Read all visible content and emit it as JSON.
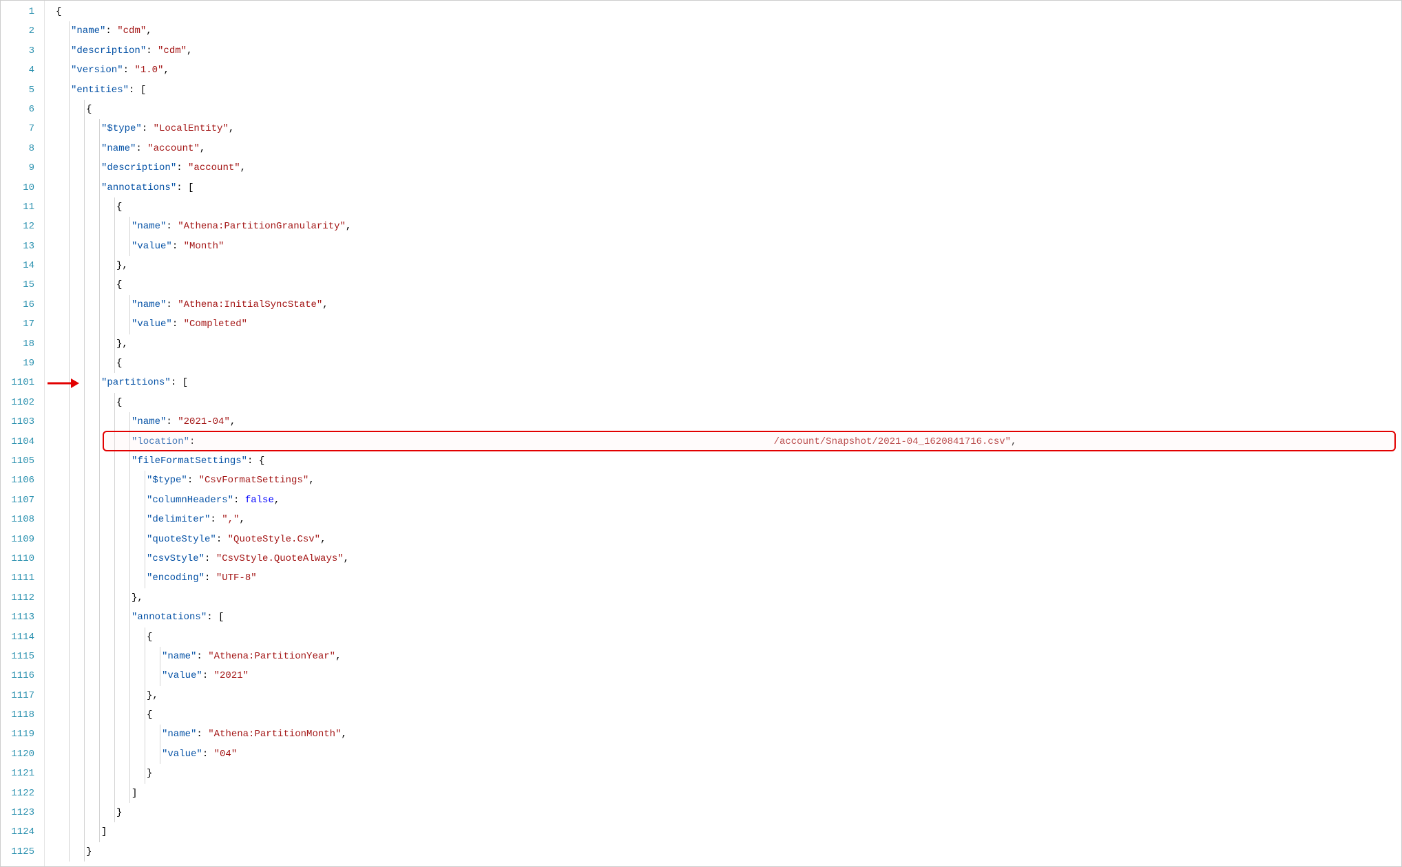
{
  "lines": [
    {
      "num": "1",
      "indent": 0,
      "tokens": [
        {
          "t": "punct",
          "v": "{"
        }
      ]
    },
    {
      "num": "2",
      "indent": 1,
      "tokens": [
        {
          "t": "key",
          "v": "\"name\""
        },
        {
          "t": "punct",
          "v": ": "
        },
        {
          "t": "str",
          "v": "\"cdm\""
        },
        {
          "t": "punct",
          "v": ","
        }
      ]
    },
    {
      "num": "3",
      "indent": 1,
      "tokens": [
        {
          "t": "key",
          "v": "\"description\""
        },
        {
          "t": "punct",
          "v": ": "
        },
        {
          "t": "str",
          "v": "\"cdm\""
        },
        {
          "t": "punct",
          "v": ","
        }
      ]
    },
    {
      "num": "4",
      "indent": 1,
      "tokens": [
        {
          "t": "key",
          "v": "\"version\""
        },
        {
          "t": "punct",
          "v": ": "
        },
        {
          "t": "str",
          "v": "\"1.0\""
        },
        {
          "t": "punct",
          "v": ","
        }
      ]
    },
    {
      "num": "5",
      "indent": 1,
      "tokens": [
        {
          "t": "key",
          "v": "\"entities\""
        },
        {
          "t": "punct",
          "v": ": ["
        }
      ]
    },
    {
      "num": "6",
      "indent": 2,
      "tokens": [
        {
          "t": "punct",
          "v": "{"
        }
      ]
    },
    {
      "num": "7",
      "indent": 3,
      "tokens": [
        {
          "t": "key",
          "v": "\"$type\""
        },
        {
          "t": "punct",
          "v": ": "
        },
        {
          "t": "str",
          "v": "\"LocalEntity\""
        },
        {
          "t": "punct",
          "v": ","
        }
      ]
    },
    {
      "num": "8",
      "indent": 3,
      "tokens": [
        {
          "t": "key",
          "v": "\"name\""
        },
        {
          "t": "punct",
          "v": ": "
        },
        {
          "t": "str",
          "v": "\"account\""
        },
        {
          "t": "punct",
          "v": ","
        }
      ]
    },
    {
      "num": "9",
      "indent": 3,
      "tokens": [
        {
          "t": "key",
          "v": "\"description\""
        },
        {
          "t": "punct",
          "v": ": "
        },
        {
          "t": "str",
          "v": "\"account\""
        },
        {
          "t": "punct",
          "v": ","
        }
      ]
    },
    {
      "num": "10",
      "indent": 3,
      "tokens": [
        {
          "t": "key",
          "v": "\"annotations\""
        },
        {
          "t": "punct",
          "v": ": ["
        }
      ]
    },
    {
      "num": "11",
      "indent": 4,
      "tokens": [
        {
          "t": "punct",
          "v": "{"
        }
      ]
    },
    {
      "num": "12",
      "indent": 5,
      "tokens": [
        {
          "t": "key",
          "v": "\"name\""
        },
        {
          "t": "punct",
          "v": ": "
        },
        {
          "t": "str",
          "v": "\"Athena:PartitionGranularity\""
        },
        {
          "t": "punct",
          "v": ","
        }
      ]
    },
    {
      "num": "13",
      "indent": 5,
      "tokens": [
        {
          "t": "key",
          "v": "\"value\""
        },
        {
          "t": "punct",
          "v": ": "
        },
        {
          "t": "str",
          "v": "\"Month\""
        }
      ]
    },
    {
      "num": "14",
      "indent": 4,
      "tokens": [
        {
          "t": "punct",
          "v": "},"
        }
      ]
    },
    {
      "num": "15",
      "indent": 4,
      "tokens": [
        {
          "t": "punct",
          "v": "{"
        }
      ]
    },
    {
      "num": "16",
      "indent": 5,
      "tokens": [
        {
          "t": "key",
          "v": "\"name\""
        },
        {
          "t": "punct",
          "v": ": "
        },
        {
          "t": "str",
          "v": "\"Athena:InitialSyncState\""
        },
        {
          "t": "punct",
          "v": ","
        }
      ]
    },
    {
      "num": "17",
      "indent": 5,
      "tokens": [
        {
          "t": "key",
          "v": "\"value\""
        },
        {
          "t": "punct",
          "v": ": "
        },
        {
          "t": "str",
          "v": "\"Completed\""
        }
      ]
    },
    {
      "num": "18",
      "indent": 4,
      "tokens": [
        {
          "t": "punct",
          "v": "},"
        }
      ]
    },
    {
      "num": "19",
      "indent": 4,
      "tokens": [
        {
          "t": "punct",
          "v": "{"
        }
      ]
    },
    {
      "num": "1101",
      "indent": 3,
      "tokens": [
        {
          "t": "key",
          "v": "\"partitions\""
        },
        {
          "t": "punct",
          "v": ": ["
        }
      ]
    },
    {
      "num": "1102",
      "indent": 4,
      "tokens": [
        {
          "t": "punct",
          "v": "{"
        }
      ]
    },
    {
      "num": "1103",
      "indent": 5,
      "tokens": [
        {
          "t": "key",
          "v": "\"name\""
        },
        {
          "t": "punct",
          "v": ": "
        },
        {
          "t": "str",
          "v": "\"2021-04\""
        },
        {
          "t": "punct",
          "v": ","
        }
      ]
    },
    {
      "num": "1104",
      "indent": 5,
      "tokens": [
        {
          "t": "key",
          "v": "\"location\""
        },
        {
          "t": "punct",
          "v": ": "
        },
        {
          "t": "str",
          "v": "                                                                                                   /account/Snapshot/2021-04_1620841716.csv\""
        },
        {
          "t": "punct",
          "v": ","
        }
      ]
    },
    {
      "num": "1105",
      "indent": 5,
      "tokens": [
        {
          "t": "key",
          "v": "\"fileFormatSettings\""
        },
        {
          "t": "punct",
          "v": ": {"
        }
      ]
    },
    {
      "num": "1106",
      "indent": 6,
      "tokens": [
        {
          "t": "key",
          "v": "\"$type\""
        },
        {
          "t": "punct",
          "v": ": "
        },
        {
          "t": "str",
          "v": "\"CsvFormatSettings\""
        },
        {
          "t": "punct",
          "v": ","
        }
      ]
    },
    {
      "num": "1107",
      "indent": 6,
      "tokens": [
        {
          "t": "key",
          "v": "\"columnHeaders\""
        },
        {
          "t": "punct",
          "v": ": "
        },
        {
          "t": "kw",
          "v": "false"
        },
        {
          "t": "punct",
          "v": ","
        }
      ]
    },
    {
      "num": "1108",
      "indent": 6,
      "tokens": [
        {
          "t": "key",
          "v": "\"delimiter\""
        },
        {
          "t": "punct",
          "v": ": "
        },
        {
          "t": "str",
          "v": "\",\""
        },
        {
          "t": "punct",
          "v": ","
        }
      ]
    },
    {
      "num": "1109",
      "indent": 6,
      "tokens": [
        {
          "t": "key",
          "v": "\"quoteStyle\""
        },
        {
          "t": "punct",
          "v": ": "
        },
        {
          "t": "str",
          "v": "\"QuoteStyle.Csv\""
        },
        {
          "t": "punct",
          "v": ","
        }
      ]
    },
    {
      "num": "1110",
      "indent": 6,
      "tokens": [
        {
          "t": "key",
          "v": "\"csvStyle\""
        },
        {
          "t": "punct",
          "v": ": "
        },
        {
          "t": "str",
          "v": "\"CsvStyle.QuoteAlways\""
        },
        {
          "t": "punct",
          "v": ","
        }
      ]
    },
    {
      "num": "1111",
      "indent": 6,
      "tokens": [
        {
          "t": "key",
          "v": "\"encoding\""
        },
        {
          "t": "punct",
          "v": ": "
        },
        {
          "t": "str",
          "v": "\"UTF-8\""
        }
      ]
    },
    {
      "num": "1112",
      "indent": 5,
      "tokens": [
        {
          "t": "punct",
          "v": "},"
        }
      ]
    },
    {
      "num": "1113",
      "indent": 5,
      "tokens": [
        {
          "t": "key",
          "v": "\"annotations\""
        },
        {
          "t": "punct",
          "v": ": ["
        }
      ]
    },
    {
      "num": "1114",
      "indent": 6,
      "tokens": [
        {
          "t": "punct",
          "v": "{"
        }
      ]
    },
    {
      "num": "1115",
      "indent": 7,
      "tokens": [
        {
          "t": "key",
          "v": "\"name\""
        },
        {
          "t": "punct",
          "v": ": "
        },
        {
          "t": "str",
          "v": "\"Athena:PartitionYear\""
        },
        {
          "t": "punct",
          "v": ","
        }
      ]
    },
    {
      "num": "1116",
      "indent": 7,
      "tokens": [
        {
          "t": "key",
          "v": "\"value\""
        },
        {
          "t": "punct",
          "v": ": "
        },
        {
          "t": "str",
          "v": "\"2021\""
        }
      ]
    },
    {
      "num": "1117",
      "indent": 6,
      "tokens": [
        {
          "t": "punct",
          "v": "},"
        }
      ]
    },
    {
      "num": "1118",
      "indent": 6,
      "tokens": [
        {
          "t": "punct",
          "v": "{"
        }
      ]
    },
    {
      "num": "1119",
      "indent": 7,
      "tokens": [
        {
          "t": "key",
          "v": "\"name\""
        },
        {
          "t": "punct",
          "v": ": "
        },
        {
          "t": "str",
          "v": "\"Athena:PartitionMonth\""
        },
        {
          "t": "punct",
          "v": ","
        }
      ]
    },
    {
      "num": "1120",
      "indent": 7,
      "tokens": [
        {
          "t": "key",
          "v": "\"value\""
        },
        {
          "t": "punct",
          "v": ": "
        },
        {
          "t": "str",
          "v": "\"04\""
        }
      ]
    },
    {
      "num": "1121",
      "indent": 6,
      "tokens": [
        {
          "t": "punct",
          "v": "}"
        }
      ]
    },
    {
      "num": "1122",
      "indent": 5,
      "tokens": [
        {
          "t": "punct",
          "v": "]"
        }
      ]
    },
    {
      "num": "1123",
      "indent": 4,
      "tokens": [
        {
          "t": "punct",
          "v": "}"
        }
      ]
    },
    {
      "num": "1124",
      "indent": 3,
      "tokens": [
        {
          "t": "punct",
          "v": "]"
        }
      ]
    },
    {
      "num": "1125",
      "indent": 2,
      "tokens": [
        {
          "t": "punct",
          "v": "}"
        }
      ]
    }
  ],
  "annotations": {
    "arrow_target_line": "1101",
    "highlight_target_line": "1104"
  }
}
